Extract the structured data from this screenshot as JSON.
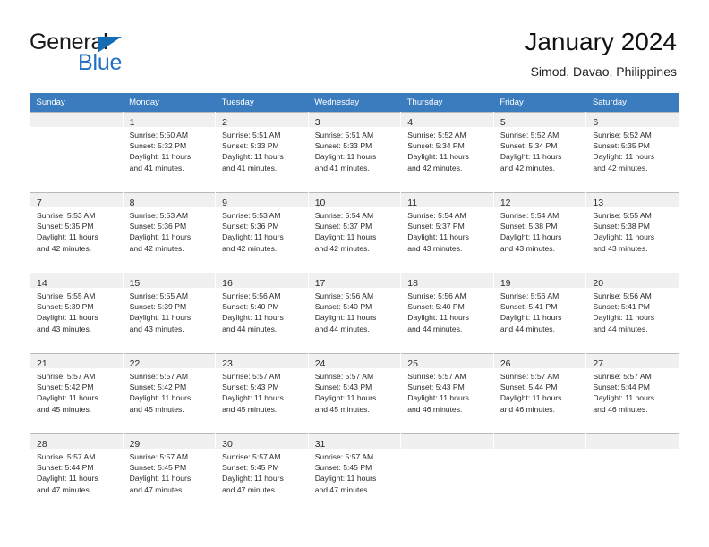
{
  "brand": {
    "name_part1": "General",
    "name_part2": "Blue",
    "triangle_color": "#156bb4",
    "blue_color": "#1f6fc4"
  },
  "header": {
    "title": "January 2024",
    "subtitle": "Simod, Davao, Philippines"
  },
  "theme": {
    "header_row_bg": "#3a7cbe",
    "day_number_bg": "#f0f0f0",
    "cell_border": "#b9b9b9",
    "text_color": "#2a2a2a"
  },
  "weekdays": [
    "Sunday",
    "Monday",
    "Tuesday",
    "Wednesday",
    "Thursday",
    "Friday",
    "Saturday"
  ],
  "labels": {
    "sunrise_prefix": "Sunrise:",
    "sunset_prefix": "Sunset:",
    "daylight_prefix": "Daylight:"
  },
  "weeks": [
    [
      {
        "day": "",
        "sunrise": "",
        "sunset": "",
        "daylight_line1": "",
        "daylight_line2": ""
      },
      {
        "day": "1",
        "sunrise": "Sunrise: 5:50 AM",
        "sunset": "Sunset: 5:32 PM",
        "daylight_line1": "Daylight: 11 hours",
        "daylight_line2": "and 41 minutes."
      },
      {
        "day": "2",
        "sunrise": "Sunrise: 5:51 AM",
        "sunset": "Sunset: 5:33 PM",
        "daylight_line1": "Daylight: 11 hours",
        "daylight_line2": "and 41 minutes."
      },
      {
        "day": "3",
        "sunrise": "Sunrise: 5:51 AM",
        "sunset": "Sunset: 5:33 PM",
        "daylight_line1": "Daylight: 11 hours",
        "daylight_line2": "and 41 minutes."
      },
      {
        "day": "4",
        "sunrise": "Sunrise: 5:52 AM",
        "sunset": "Sunset: 5:34 PM",
        "daylight_line1": "Daylight: 11 hours",
        "daylight_line2": "and 42 minutes."
      },
      {
        "day": "5",
        "sunrise": "Sunrise: 5:52 AM",
        "sunset": "Sunset: 5:34 PM",
        "daylight_line1": "Daylight: 11 hours",
        "daylight_line2": "and 42 minutes."
      },
      {
        "day": "6",
        "sunrise": "Sunrise: 5:52 AM",
        "sunset": "Sunset: 5:35 PM",
        "daylight_line1": "Daylight: 11 hours",
        "daylight_line2": "and 42 minutes."
      }
    ],
    [
      {
        "day": "7",
        "sunrise": "Sunrise: 5:53 AM",
        "sunset": "Sunset: 5:35 PM",
        "daylight_line1": "Daylight: 11 hours",
        "daylight_line2": "and 42 minutes."
      },
      {
        "day": "8",
        "sunrise": "Sunrise: 5:53 AM",
        "sunset": "Sunset: 5:36 PM",
        "daylight_line1": "Daylight: 11 hours",
        "daylight_line2": "and 42 minutes."
      },
      {
        "day": "9",
        "sunrise": "Sunrise: 5:53 AM",
        "sunset": "Sunset: 5:36 PM",
        "daylight_line1": "Daylight: 11 hours",
        "daylight_line2": "and 42 minutes."
      },
      {
        "day": "10",
        "sunrise": "Sunrise: 5:54 AM",
        "sunset": "Sunset: 5:37 PM",
        "daylight_line1": "Daylight: 11 hours",
        "daylight_line2": "and 42 minutes."
      },
      {
        "day": "11",
        "sunrise": "Sunrise: 5:54 AM",
        "sunset": "Sunset: 5:37 PM",
        "daylight_line1": "Daylight: 11 hours",
        "daylight_line2": "and 43 minutes."
      },
      {
        "day": "12",
        "sunrise": "Sunrise: 5:54 AM",
        "sunset": "Sunset: 5:38 PM",
        "daylight_line1": "Daylight: 11 hours",
        "daylight_line2": "and 43 minutes."
      },
      {
        "day": "13",
        "sunrise": "Sunrise: 5:55 AM",
        "sunset": "Sunset: 5:38 PM",
        "daylight_line1": "Daylight: 11 hours",
        "daylight_line2": "and 43 minutes."
      }
    ],
    [
      {
        "day": "14",
        "sunrise": "Sunrise: 5:55 AM",
        "sunset": "Sunset: 5:39 PM",
        "daylight_line1": "Daylight: 11 hours",
        "daylight_line2": "and 43 minutes."
      },
      {
        "day": "15",
        "sunrise": "Sunrise: 5:55 AM",
        "sunset": "Sunset: 5:39 PM",
        "daylight_line1": "Daylight: 11 hours",
        "daylight_line2": "and 43 minutes."
      },
      {
        "day": "16",
        "sunrise": "Sunrise: 5:56 AM",
        "sunset": "Sunset: 5:40 PM",
        "daylight_line1": "Daylight: 11 hours",
        "daylight_line2": "and 44 minutes."
      },
      {
        "day": "17",
        "sunrise": "Sunrise: 5:56 AM",
        "sunset": "Sunset: 5:40 PM",
        "daylight_line1": "Daylight: 11 hours",
        "daylight_line2": "and 44 minutes."
      },
      {
        "day": "18",
        "sunrise": "Sunrise: 5:56 AM",
        "sunset": "Sunset: 5:40 PM",
        "daylight_line1": "Daylight: 11 hours",
        "daylight_line2": "and 44 minutes."
      },
      {
        "day": "19",
        "sunrise": "Sunrise: 5:56 AM",
        "sunset": "Sunset: 5:41 PM",
        "daylight_line1": "Daylight: 11 hours",
        "daylight_line2": "and 44 minutes."
      },
      {
        "day": "20",
        "sunrise": "Sunrise: 5:56 AM",
        "sunset": "Sunset: 5:41 PM",
        "daylight_line1": "Daylight: 11 hours",
        "daylight_line2": "and 44 minutes."
      }
    ],
    [
      {
        "day": "21",
        "sunrise": "Sunrise: 5:57 AM",
        "sunset": "Sunset: 5:42 PM",
        "daylight_line1": "Daylight: 11 hours",
        "daylight_line2": "and 45 minutes."
      },
      {
        "day": "22",
        "sunrise": "Sunrise: 5:57 AM",
        "sunset": "Sunset: 5:42 PM",
        "daylight_line1": "Daylight: 11 hours",
        "daylight_line2": "and 45 minutes."
      },
      {
        "day": "23",
        "sunrise": "Sunrise: 5:57 AM",
        "sunset": "Sunset: 5:43 PM",
        "daylight_line1": "Daylight: 11 hours",
        "daylight_line2": "and 45 minutes."
      },
      {
        "day": "24",
        "sunrise": "Sunrise: 5:57 AM",
        "sunset": "Sunset: 5:43 PM",
        "daylight_line1": "Daylight: 11 hours",
        "daylight_line2": "and 45 minutes."
      },
      {
        "day": "25",
        "sunrise": "Sunrise: 5:57 AM",
        "sunset": "Sunset: 5:43 PM",
        "daylight_line1": "Daylight: 11 hours",
        "daylight_line2": "and 46 minutes."
      },
      {
        "day": "26",
        "sunrise": "Sunrise: 5:57 AM",
        "sunset": "Sunset: 5:44 PM",
        "daylight_line1": "Daylight: 11 hours",
        "daylight_line2": "and 46 minutes."
      },
      {
        "day": "27",
        "sunrise": "Sunrise: 5:57 AM",
        "sunset": "Sunset: 5:44 PM",
        "daylight_line1": "Daylight: 11 hours",
        "daylight_line2": "and 46 minutes."
      }
    ],
    [
      {
        "day": "28",
        "sunrise": "Sunrise: 5:57 AM",
        "sunset": "Sunset: 5:44 PM",
        "daylight_line1": "Daylight: 11 hours",
        "daylight_line2": "and 47 minutes."
      },
      {
        "day": "29",
        "sunrise": "Sunrise: 5:57 AM",
        "sunset": "Sunset: 5:45 PM",
        "daylight_line1": "Daylight: 11 hours",
        "daylight_line2": "and 47 minutes."
      },
      {
        "day": "30",
        "sunrise": "Sunrise: 5:57 AM",
        "sunset": "Sunset: 5:45 PM",
        "daylight_line1": "Daylight: 11 hours",
        "daylight_line2": "and 47 minutes."
      },
      {
        "day": "31",
        "sunrise": "Sunrise: 5:57 AM",
        "sunset": "Sunset: 5:45 PM",
        "daylight_line1": "Daylight: 11 hours",
        "daylight_line2": "and 47 minutes."
      },
      {
        "day": "",
        "sunrise": "",
        "sunset": "",
        "daylight_line1": "",
        "daylight_line2": ""
      },
      {
        "day": "",
        "sunrise": "",
        "sunset": "",
        "daylight_line1": "",
        "daylight_line2": ""
      },
      {
        "day": "",
        "sunrise": "",
        "sunset": "",
        "daylight_line1": "",
        "daylight_line2": ""
      }
    ]
  ]
}
